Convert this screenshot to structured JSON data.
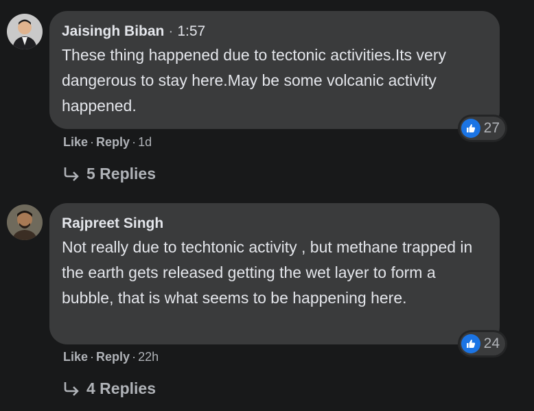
{
  "comments": [
    {
      "author": "Jaisingh Biban",
      "separator": "·",
      "time": "1:57",
      "text": "These thing happened due to tectonic activities.Its very dangerous to stay here.May be some volcanic activity happened.",
      "reaction_count": "27",
      "like_label": "Like",
      "reply_label": "Reply",
      "dot": "·",
      "age": "1d",
      "replies_label": "5 Replies"
    },
    {
      "author": "Rajpreet Singh",
      "text": "Not really due to techtonic activity , but methane trapped in the earth gets released getting the wet layer to form a bubble, that is what seems to be happening here.",
      "reaction_count": "24",
      "like_label": "Like",
      "reply_label": "Reply",
      "dot": "·",
      "age": "22h",
      "replies_label": "4 Replies"
    }
  ],
  "colors": {
    "background": "#18191a",
    "bubble": "#3a3b3c",
    "like_blue": "#1b74e4",
    "secondary_text": "#b0b3b8"
  },
  "icons": {
    "like": "thumbs-up-icon",
    "reply_arrow": "reply-arrow-icon"
  }
}
